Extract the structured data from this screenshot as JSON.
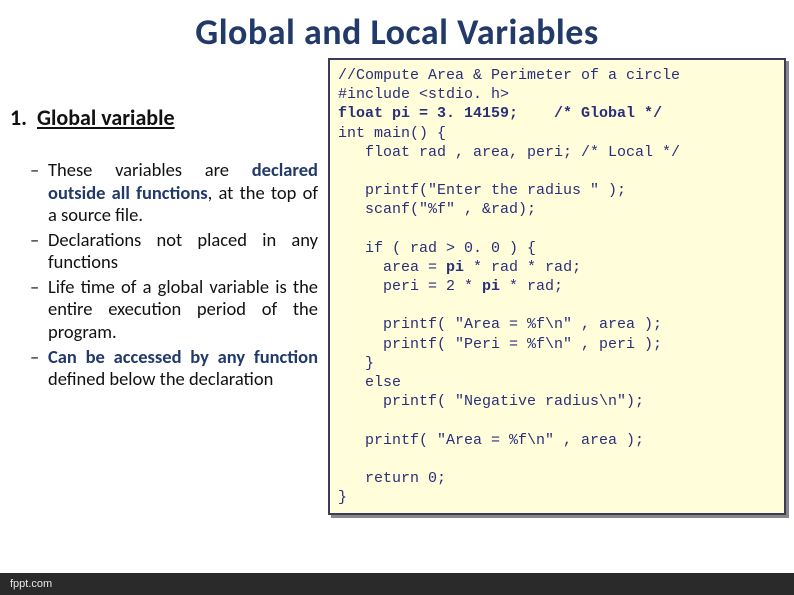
{
  "title": "Global  and Local Variables",
  "heading": {
    "num": "1.",
    "text": "Global variable"
  },
  "bullets": [
    {
      "pre": "These variables are ",
      "bold": "declared outside all functions",
      "post": ", at the top of a source file."
    },
    {
      "pre": "Declarations not placed in any functions",
      "bold": "",
      "post": ""
    },
    {
      "pre": "Life time of a global variable is the entire execution period of the program.",
      "bold": "",
      "post": ""
    },
    {
      "pre": "",
      "bold": "Can be accessed by any function",
      "post": " defined below the declaration"
    }
  ],
  "code": {
    "l1": "//Compute Area & Perimeter of a circle",
    "l2": "#include <stdio. h>",
    "l3a": "float pi = 3. 14159;",
    "l3b": "/* Global */",
    "l4": "int main() {",
    "l5": "   float rad , area, peri; /* Local */",
    "l6": "",
    "l7": "   printf(\"Enter the radius \" );",
    "l8": "   scanf(\"%f\" , &rad);",
    "l9": "",
    "l10": "   if ( rad > 0. 0 ) {",
    "l11a": "     area = ",
    "l11b": "pi",
    "l11c": " * rad * rad;",
    "l12a": "     peri = 2 * ",
    "l12b": "pi",
    "l12c": " * rad;",
    "l13": "",
    "l14": "     printf( \"Area = %f\\n\" , area );",
    "l15": "     printf( \"Peri = %f\\n\" , peri );",
    "l16": "   }",
    "l17": "   else",
    "l18": "     printf( \"Negative radius\\n\");",
    "l19": "",
    "l20": "   printf( \"Area = %f\\n\" , area );",
    "l21": "",
    "l22": "   return 0;",
    "l23": "}"
  },
  "footer": "fppt.com"
}
